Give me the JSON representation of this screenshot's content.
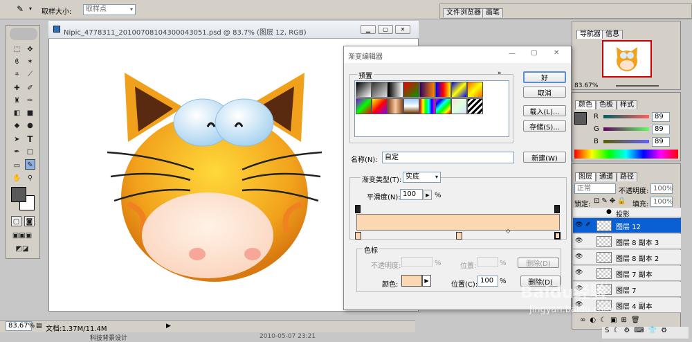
{
  "options_bar": {
    "label": "取样大小:",
    "select": "取样点"
  },
  "right_tabs": {
    "file_browser": "文件浏览器",
    "brushes": "画笔"
  },
  "document": {
    "title": "Nipic_4778311_20100708104300043051.psd @ 83.7% (图层 12, RGB)",
    "zoom": "83.67%",
    "doc_info": "文档:1.37M/11.4M",
    "bottom_text": "科技背景设计",
    "bottom_date": "2010-05-07 23:21"
  },
  "navigator": {
    "tab1": "导航器",
    "tab2": "信息",
    "zoom": "83.67%"
  },
  "color_panel": {
    "tab1": "颜色",
    "tab2": "色板",
    "tab3": "样式",
    "r_label": "R",
    "g_label": "G",
    "b_label": "B",
    "r": "89",
    "g": "89",
    "b": "89"
  },
  "layers": {
    "tab1": "图层",
    "tab2": "通道",
    "tab3": "路径",
    "mode": "正常",
    "opacity_label": "不透明度:",
    "opacity": "100%",
    "lock_label": "锁定:",
    "fill_label": "填充:",
    "fill": "100%",
    "effect": "投影",
    "items": [
      "图层 12",
      "图层 8 副本 3",
      "图层 8 副本 2",
      "图层 7 副本",
      "图层 7",
      "图层 4 副本"
    ]
  },
  "dialog": {
    "title": "渐变编辑器",
    "presets_label": "预置",
    "ok": "好",
    "cancel": "取消",
    "load": "载入(L)...",
    "save": "存储(S)...",
    "name_label": "名称(N):",
    "name_value": "自定",
    "new": "新建(W)",
    "type_label": "渐变类型(T):",
    "type_value": "实底",
    "smooth_label": "平滑度(N):",
    "smooth_value": "100",
    "pct": "%",
    "stops_label": "色标",
    "opacity_label": "不透明度:",
    "location_label": "位置:",
    "delete": "删除(D)",
    "color_label": "颜色:",
    "location2_label": "位置(C):",
    "location2_value": "100"
  },
  "watermark": {
    "baidu": "Baidu经验",
    "url": "jingyan.baidu.com"
  },
  "colors": {
    "gradient": "#fcd8b2",
    "accent": "#0a5fd4",
    "cat_orange": "#f2a21c"
  }
}
